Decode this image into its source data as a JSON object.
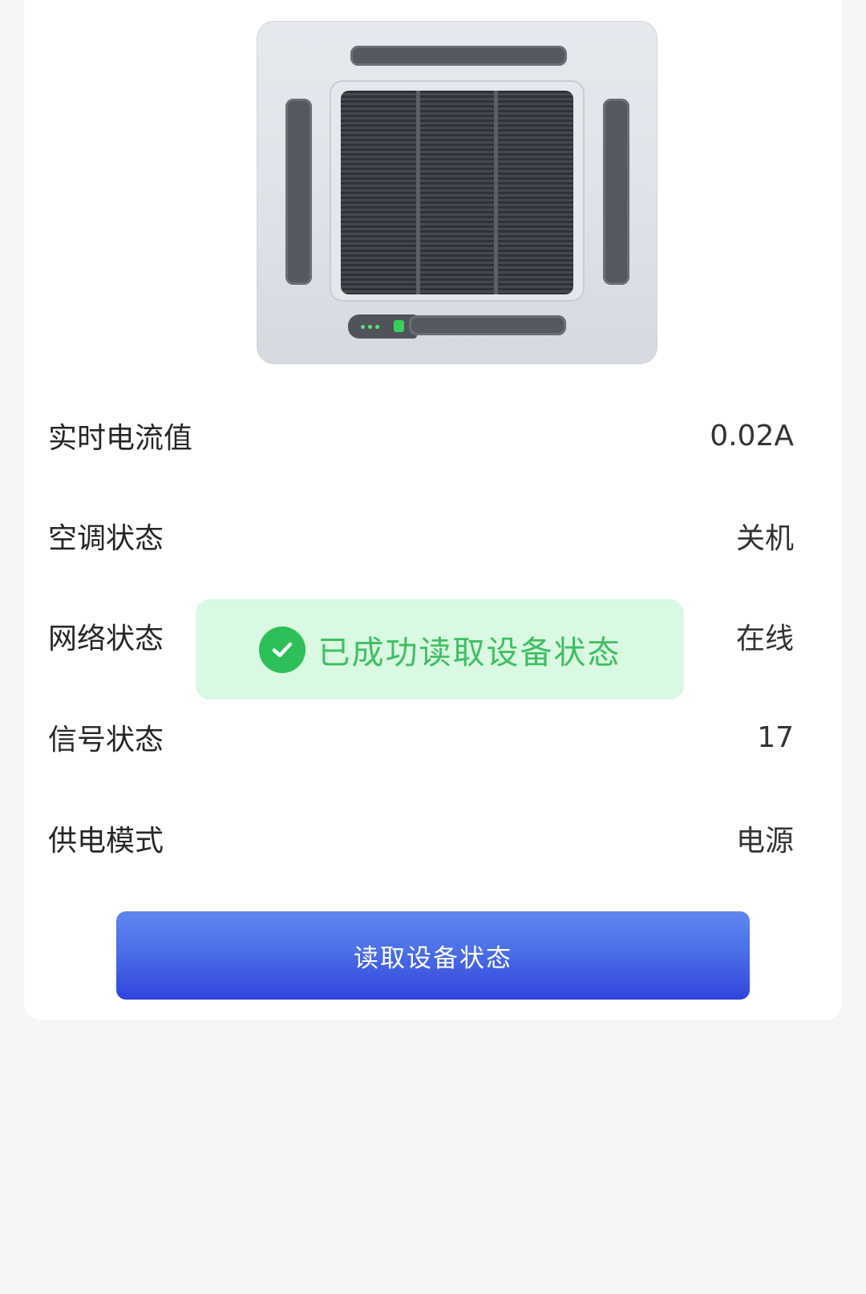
{
  "device_image": {
    "icon": "ceiling-cassette-air-conditioner"
  },
  "status_rows": [
    {
      "label": "实时电流值",
      "value": "0.02A"
    },
    {
      "label": "空调状态",
      "value": "关机"
    },
    {
      "label": "网络状态",
      "value": "在线"
    },
    {
      "label": "信号状态",
      "value": "17"
    },
    {
      "label": "供电模式",
      "value": "电源"
    }
  ],
  "toast": {
    "text": "已成功读取设备状态",
    "icon": "check-circle-icon",
    "color": "#2dc05a"
  },
  "actions": {
    "read_button_label": "读取设备状态",
    "button_color": "#4b6fe8"
  }
}
